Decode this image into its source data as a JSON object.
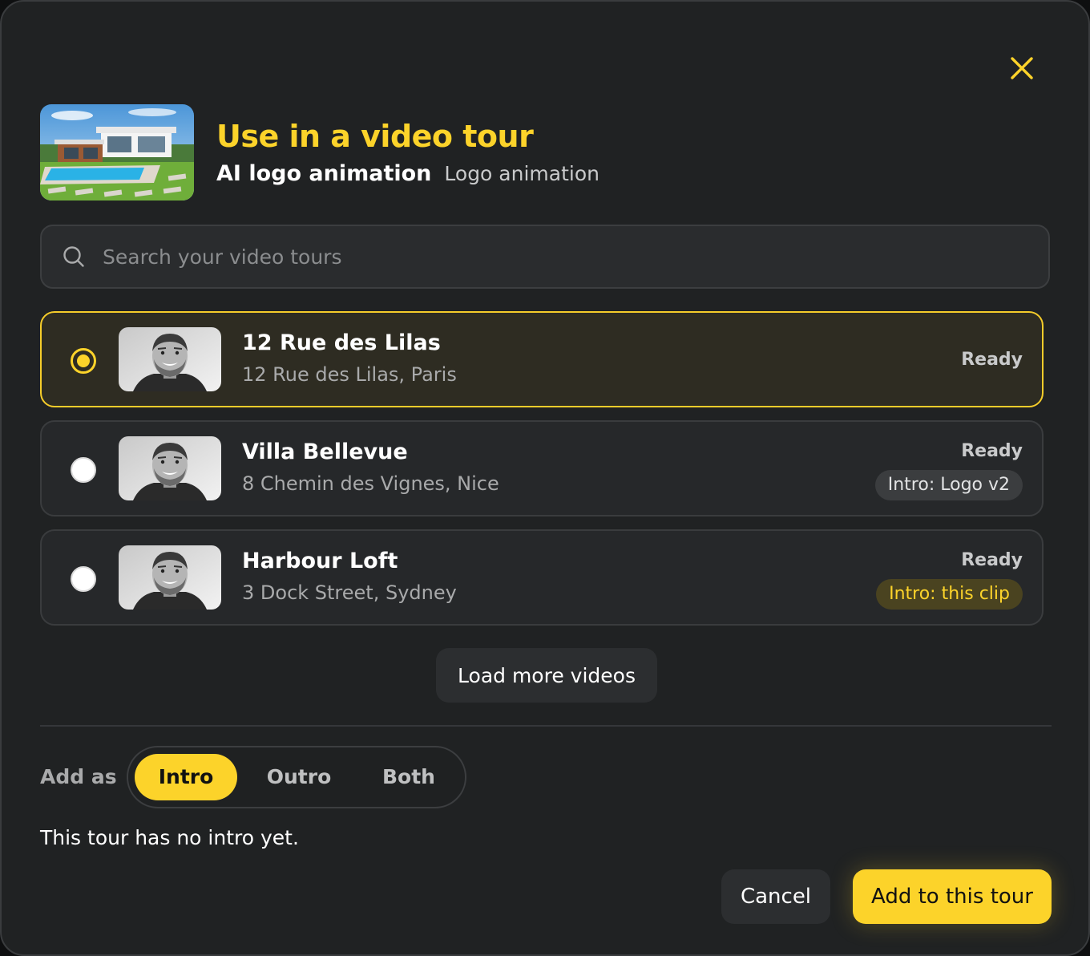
{
  "dialog": {
    "title": "Use in a video tour",
    "clip_name": "AI logo animation",
    "clip_type": "Logo animation",
    "close_icon": "close-icon",
    "hero_image": "villa-with-pool-photo"
  },
  "search": {
    "placeholder": "Search your video tours",
    "value": "",
    "icon": "search-icon"
  },
  "tours": [
    {
      "name": "12 Rue des Lilas",
      "address": "12 Rue des Lilas, Paris",
      "status": "Ready",
      "intro": "",
      "selected": true
    },
    {
      "name": "Villa Bellevue",
      "address": "8 Chemin des Vignes, Nice",
      "status": "Ready",
      "intro": "Intro: Logo v2",
      "selected": false
    },
    {
      "name": "Harbour Loft",
      "address": "3 Dock Street, Sydney",
      "status": "Ready",
      "intro": "Intro: this clip",
      "selected": false
    }
  ],
  "load_more_label": "Load more videos",
  "add_as": {
    "label": "Add as",
    "options": [
      "Intro",
      "Outro",
      "Both"
    ],
    "selected": "Intro"
  },
  "hint": "This tour has no intro yet.",
  "actions": {
    "cancel_label": "Cancel",
    "confirm_label": "Add to this tour"
  },
  "colors": {
    "accent": "#fcd32a",
    "background": "#202223",
    "card": "#26282a",
    "selected_card": "#2e2c22"
  }
}
